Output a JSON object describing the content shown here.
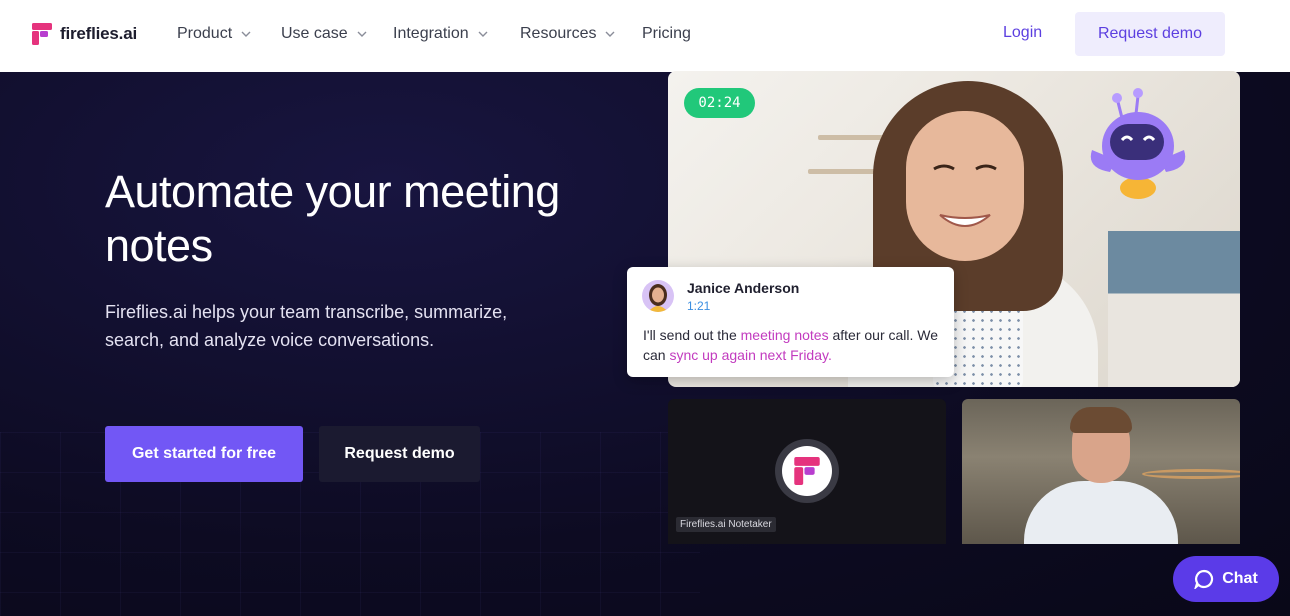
{
  "brand": {
    "name": "fireflies.ai",
    "logo_color": "#e5337d"
  },
  "nav": {
    "items": [
      {
        "label": "Product",
        "has_dropdown": true
      },
      {
        "label": "Use case",
        "has_dropdown": true
      },
      {
        "label": "Integration",
        "has_dropdown": true
      },
      {
        "label": "Resources",
        "has_dropdown": true
      },
      {
        "label": "Pricing",
        "has_dropdown": false
      }
    ],
    "login_label": "Login",
    "request_demo_label": "Request demo"
  },
  "hero": {
    "headline": "Automate your meeting notes",
    "subhead": "Fireflies.ai helps your team transcribe, summarize, search, and analyze voice conversations.",
    "primary_cta": "Get started for free",
    "secondary_cta": "Request demo"
  },
  "video": {
    "timer": "02:24",
    "caption_card": {
      "speaker": "Janice Anderson",
      "timestamp": "1:21",
      "text_parts": [
        {
          "text": "I'll send out the ",
          "highlight": false
        },
        {
          "text": "meeting notes",
          "highlight": true
        },
        {
          "text": " after our call. We can ",
          "highlight": false
        },
        {
          "text": "sync up again next Friday.",
          "highlight": true
        }
      ]
    },
    "notetaker_label": "Fireflies.ai Notetaker"
  },
  "chat_widget": {
    "label": "Chat"
  },
  "colors": {
    "accent": "#7257f5",
    "timer_green": "#21c87a",
    "highlight": "#c23bbf",
    "nav_link": "#5c3fe0"
  }
}
